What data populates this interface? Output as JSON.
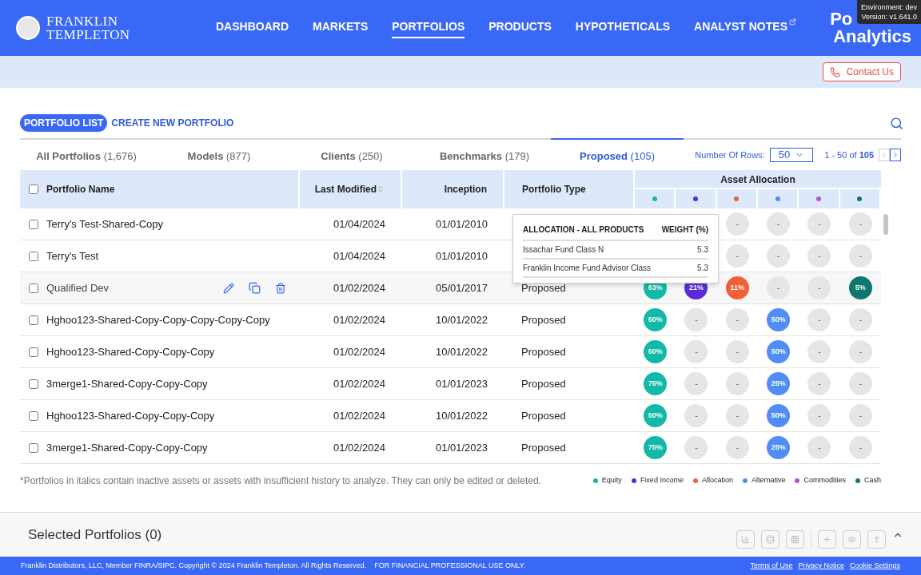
{
  "brand": {
    "line1": "FRANKLIN",
    "line2": "TEMPLETON"
  },
  "nav": [
    {
      "label": "DASHBOARD",
      "selected": false,
      "external": false
    },
    {
      "label": "MARKETS",
      "selected": false,
      "external": false
    },
    {
      "label": "PORTFOLIOS",
      "selected": true,
      "external": false
    },
    {
      "label": "PRODUCTS",
      "selected": false,
      "external": false
    },
    {
      "label": "HYPOTHETICALS",
      "selected": false,
      "external": false
    },
    {
      "label": "ANALYST NOTES",
      "selected": false,
      "external": true
    }
  ],
  "app_title": {
    "line1": "Po",
    "line2": "Analytics"
  },
  "env_badge": {
    "line1": "Environment: dev",
    "line2": "Version: v1.641.0"
  },
  "contact_button": "Contact Us",
  "view_tabs": [
    {
      "label": "PORTFOLIO LIST",
      "selected": true
    },
    {
      "label": "CREATE NEW PORTFOLIO",
      "selected": false
    }
  ],
  "category_tabs": [
    {
      "label": "All Portfolios",
      "count": "(1,676)",
      "selected": false
    },
    {
      "label": "Models",
      "count": "(877)",
      "selected": false
    },
    {
      "label": "Clients",
      "count": "(250)",
      "selected": false
    },
    {
      "label": "Benchmarks",
      "count": "(179)",
      "selected": false
    },
    {
      "label": "Proposed",
      "count": "(105)",
      "selected": true
    }
  ],
  "rows_control": {
    "label": "Number Of Rows:",
    "value": "50",
    "range": "1 - 50 of",
    "total": "105"
  },
  "select_all_checked": false,
  "columns": [
    "Portfolio Name",
    "Last Modified",
    "Inception",
    "Portfolio Type",
    "Asset Allocation"
  ],
  "asset_classes": [
    {
      "name": "Equity",
      "color": "#14b8a6"
    },
    {
      "name": "Fixed Income",
      "color": "#5b2bd6"
    },
    {
      "name": "Allocation",
      "color": "#f2603a"
    },
    {
      "name": "Alternative",
      "color": "#4f8ef7"
    },
    {
      "name": "Commodities",
      "color": "#b452d9"
    },
    {
      "name": "Cash",
      "color": "#0f766e"
    }
  ],
  "rows": [
    {
      "name": "Terry's Test-Shared-Copy",
      "modified": "01/04/2024",
      "inception": "01/01/2010",
      "hovered": false,
      "allocations": [
        "-",
        "-",
        "-",
        "-"
      ]
    },
    {
      "name": "Terry's Test",
      "modified": "01/04/2024",
      "inception": "01/01/2010",
      "hovered": false,
      "allocations": [
        "-",
        "-",
        "-",
        "-"
      ]
    },
    {
      "name": "Qualified Dev",
      "modified": "01/02/2024",
      "inception": "05/01/2017",
      "type": "Proposed",
      "hovered": true,
      "allocations": [
        "63%",
        "21%",
        "11%",
        "-",
        "-",
        "5%"
      ]
    },
    {
      "name": "Hghoo123-Shared-Copy-Copy-Copy-Copy-Copy",
      "modified": "01/02/2024",
      "inception": "10/01/2022",
      "type": "Proposed",
      "hovered": false,
      "allocations": [
        "50%",
        "-",
        "-",
        "50%",
        "-",
        "-"
      ]
    },
    {
      "name": "Hghoo123-Shared-Copy-Copy-Copy",
      "modified": "01/02/2024",
      "inception": "10/01/2022",
      "type": "Proposed",
      "hovered": false,
      "allocations": [
        "50%",
        "-",
        "-",
        "50%",
        "-",
        "-"
      ]
    },
    {
      "name": "3merge1-Shared-Copy-Copy-Copy",
      "modified": "01/02/2024",
      "inception": "01/01/2023",
      "type": "Proposed",
      "hovered": false,
      "allocations": [
        "75%",
        "-",
        "-",
        "25%",
        "-",
        "-"
      ]
    },
    {
      "name": "Hghoo123-Shared-Copy-Copy-Copy",
      "modified": "01/02/2024",
      "inception": "10/01/2022",
      "type": "Proposed",
      "hovered": false,
      "allocations": [
        "50%",
        "-",
        "-",
        "50%",
        "-",
        "-"
      ]
    },
    {
      "name": "3merge1-Shared-Copy-Copy-Copy",
      "modified": "01/02/2024",
      "inception": "01/01/2023",
      "type": "Proposed",
      "hovered": false,
      "allocations": [
        "75%",
        "-",
        "-",
        "25%",
        "-",
        "-"
      ]
    }
  ],
  "tooltip": {
    "headers": [
      "ALLOCATION - ALL PRODUCTS",
      "WEIGHT (%)"
    ],
    "items": [
      {
        "name": "Issachar Fund Class N",
        "weight": "5.3"
      },
      {
        "name": "Franklin Income Fund Advisor Class",
        "weight": "5.3"
      }
    ]
  },
  "footnote": "*Portfolios in italics contain inactive assets or assets with insufficient history to analyze. They can only be edited or deleted.",
  "selected_panel": "Selected Portfolios (0)",
  "footer": {
    "text": "Franklin Distributors, LLC, Member FINRA/SIPC. Copyright © 2024 Franklin Templeton. All Rights Reserved.    FOR FINANCIAL PROFESSIONAL USE ONLY.",
    "links": [
      "Terms of Use",
      "Privacy Notice",
      "Cookie Settings"
    ]
  }
}
